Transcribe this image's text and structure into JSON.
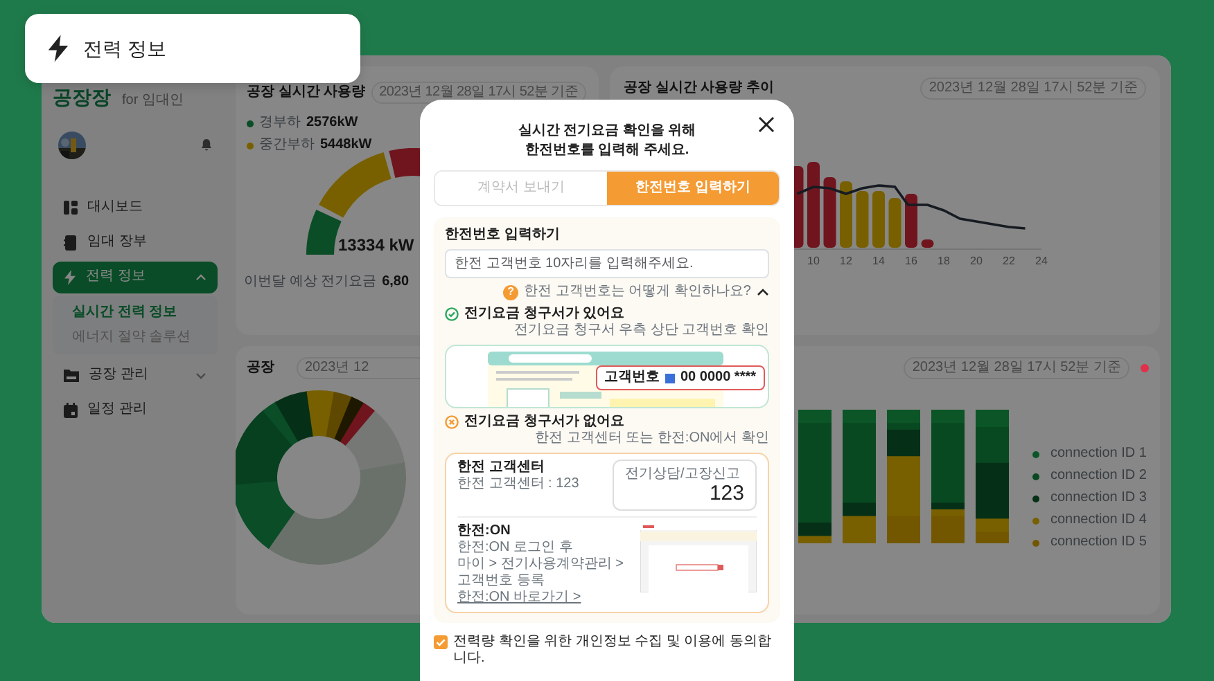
{
  "header_chip": {
    "title": "전력 정보"
  },
  "sidebar": {
    "logo": "공장장",
    "logo_subtitle": "for 임대인",
    "items": [
      {
        "kind": "link",
        "label": "대시보드",
        "selected": false
      },
      {
        "kind": "link",
        "label": "임대 장부",
        "selected": false
      },
      {
        "kind": "group",
        "label": "전력 정보",
        "selected": true,
        "expanded": true,
        "children": [
          {
            "label": "실시간 전력 정보",
            "selected": true
          },
          {
            "label": "에너지 절약 솔루션",
            "selected": false
          }
        ]
      },
      {
        "kind": "group",
        "label": "공장 관리",
        "selected": false,
        "expanded": false
      },
      {
        "kind": "link",
        "label": "일정 관리",
        "selected": false
      }
    ]
  },
  "usage_card": {
    "title": "공장 실시간 사용량",
    "timestamp": "2023년 12월 28일 17시 52분 기준",
    "legend": [
      {
        "label": "경부하",
        "value": "2576kW",
        "color": "#0a4d27"
      },
      {
        "label": "중간부하",
        "value": "5448kW",
        "color": "#786000"
      }
    ],
    "total": "13334 kW",
    "forecast_label": "이번달 예상 전기요금",
    "forecast_value": "6,80"
  },
  "trend_card": {
    "title": "공장 실시간 사용량 추이",
    "timestamp": "2023년 12월 28일 17시 52분 기준",
    "x_labels": [
      "10",
      "12",
      "14",
      "16",
      "18",
      "20",
      "22",
      "24"
    ]
  },
  "donut_card": {
    "title": "공장",
    "timestamp": "2023년 12"
  },
  "connections_card": {
    "timestamp": "2023년 12월 28일 17시 52분 기준",
    "live": true,
    "legend": [
      {
        "label": "connection ID 1",
        "color": "#0b5527"
      },
      {
        "label": "connection ID 2",
        "color": "#084921"
      },
      {
        "label": "connection ID 3",
        "color": "#053017"
      },
      {
        "label": "connection ID 4",
        "color": "#786000"
      },
      {
        "label": "connection ID 5",
        "color": "#735700"
      }
    ]
  },
  "modal": {
    "title_lines": [
      "실시간 전기요금 확인을 위해",
      "한전번호를 입력해 주세요."
    ],
    "tabs": [
      {
        "label": "계약서 보내기",
        "selected": false
      },
      {
        "label": "한전번호 입력하기",
        "selected": true
      }
    ],
    "section_title": "한전번호 입력하기",
    "input": {
      "placeholder": "한전 고객번호 10자리를 입력해주세요."
    },
    "help": {
      "icon": "?",
      "label": "한전 고객번호는 어떻게 확인하나요?",
      "expanded": true
    },
    "options": [
      {
        "kind": "has_bill",
        "title": "전기요금 청구서가 있어요",
        "caption": "전기요금 청구서 우측 상단 고객번호 확인",
        "highlight_label": "고객번호",
        "highlight_value": "00 0000 ****"
      },
      {
        "kind": "no_bill",
        "title": "전기요금 청구서가 없어요",
        "caption": "한전 고객센터 또는 한전:ON에서 확인",
        "methods": [
          {
            "kind": "phone",
            "title": "한전 고객센터",
            "lines": [
              "한전 고객센터 : 123"
            ],
            "card_title": "전기상담/고장신고",
            "card_number": "123"
          },
          {
            "kind": "web",
            "title": "한전:ON",
            "lines": [
              "한전:ON 로그인 후",
              "마이 > 전기사용계약관리 > 고객번호 등록"
            ],
            "link": "한전:ON 바로가기 >"
          }
        ]
      }
    ],
    "consent": {
      "label": "전력량 확인을 위한 개인정보 수집 및 이용에 동의합니다.",
      "checked": true
    }
  }
}
